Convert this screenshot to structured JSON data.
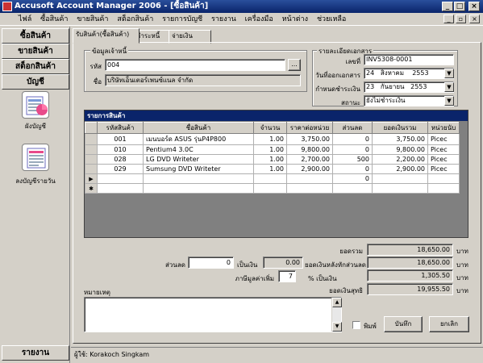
{
  "window": {
    "title": "Accusoft Account Manager 2006 - [ซื้อสินค้า]"
  },
  "menu": [
    "ไฟล์",
    "ซื้อสินค้า",
    "ขายสินค้า",
    "สต็อกสินค้า",
    "รายการบัญชี",
    "รายงาน",
    "เครื่องมือ",
    "หน้าต่าง",
    "ช่วยเหลือ"
  ],
  "sidebar": {
    "buttons": [
      "ซื้อสินค้า",
      "ขายสินค้า",
      "สต็อกสินค้า",
      "บัญชี"
    ],
    "items": [
      {
        "label": "ผังบัญชี",
        "icon": "chart-of-accounts-icon"
      },
      {
        "label": "ลงบัญชีรายวัน",
        "icon": "journal-entry-icon"
      }
    ],
    "report_button": "รายงาน"
  },
  "tabs": [
    "รับสินค้า(ซื้อสินค้า)",
    "ชำระหนี้",
    "จ่ายเงิน"
  ],
  "supplier": {
    "group_title": "ข้อมูลเจ้าหนี้",
    "code_label": "รหัส",
    "code_value": "004",
    "browse_label": "...",
    "name_label": "ชื่อ",
    "name_value": "บริษัทเอ็นเตอร์เพนซ์แนล จำกัด"
  },
  "document": {
    "group_title": "รายละเอียดเอกสาร",
    "number_label": "เลขที่",
    "number_value": "INV5308-0001",
    "issue_label": "วันที่ออกเอกสาร",
    "issue_day": "24",
    "issue_month": "สิงหาคม",
    "issue_year": "2553",
    "due_label": "กำหนดชำระเงิน",
    "due_day": "23",
    "due_month": "กันยายน",
    "due_year": "2553",
    "status_label": "สถานะ",
    "status_value": "ยังไม่ชำระเงิน"
  },
  "items_table": {
    "title": "รายการสินค้า",
    "columns": [
      "รหัสสินค้า",
      "ชื่อสินค้า",
      "จำนวน",
      "ราคาต่อหน่วย",
      "ส่วนลด",
      "ยอดเงินรวม",
      "หน่วยนับ"
    ],
    "rows": [
      {
        "code": "001",
        "name": "เมนบอร์ด ASUS รุ่นP4P800",
        "qty": "1.00",
        "price": "3,750.00",
        "discount": "0",
        "total": "3,750.00",
        "unit": "Picec"
      },
      {
        "code": "010",
        "name": "Pentium4  3.0C",
        "qty": "1.00",
        "price": "9,800.00",
        "discount": "0",
        "total": "9,800.00",
        "unit": "Picec"
      },
      {
        "code": "028",
        "name": "LG DVD Writeter",
        "qty": "1.00",
        "price": "2,700.00",
        "discount": "500",
        "total": "2,200.00",
        "unit": "Picec"
      },
      {
        "code": "029",
        "name": "Sumsung DVD Writeter",
        "qty": "1.00",
        "price": "2,900.00",
        "discount": "0",
        "total": "2,900.00",
        "unit": "Picec"
      }
    ],
    "new_row_discount": "0",
    "current_row_marker": "▶",
    "new_row_marker": "✱"
  },
  "totals": {
    "sum_label": "ยอดรวม",
    "sum_value": "18,650.00",
    "currency": "บาท",
    "discount_label": "ส่วนลด",
    "discount_value": "0",
    "discount_unit": "เป็นเงิน",
    "discount_amount": "0.00",
    "after_discount_label": "ยอดเงินหลังหักส่วนลด",
    "after_discount_value": "18,650.00",
    "vat_label": "ภาษีมูลค่าเพิ่ม",
    "vat_rate": "7",
    "vat_unit": "% เป็นเงิน",
    "vat_value": "1,305.50",
    "net_label": "ยอดเงินสุทธิ",
    "net_value": "19,955.50"
  },
  "notes": {
    "label": "หมายเหตุ",
    "value": ""
  },
  "actions": {
    "print_label": "พิมพ์",
    "save_label": "บันทึก",
    "cancel_label": "ยกเลิก"
  },
  "status": {
    "user_label": "ผู้ใช้: Korakoch Singkam"
  }
}
